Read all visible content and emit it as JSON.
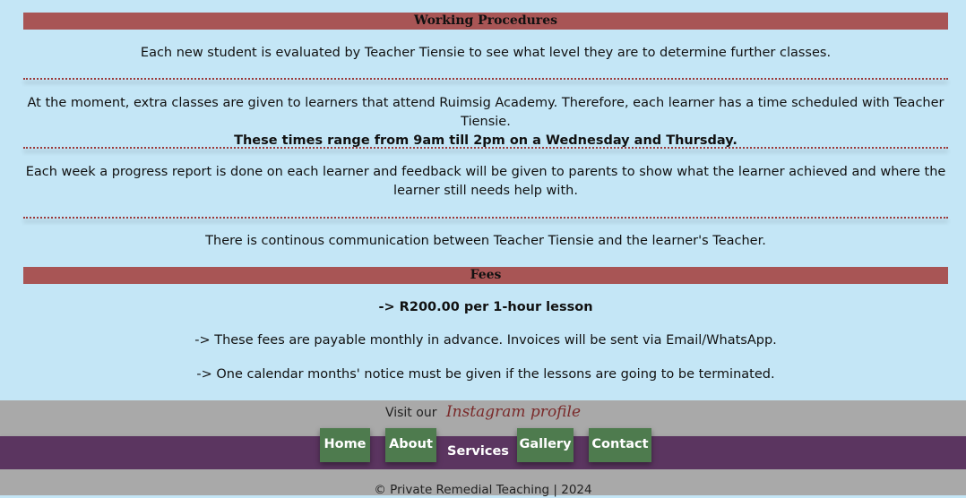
{
  "procedures": {
    "title": "Working Procedures",
    "p1": "Each new student is evaluated by Teacher Tiensie to see what level they are to determine further classes.",
    "p2_line1": "At the moment, extra classes are given to learners that attend Ruimsig Academy. Therefore, each learner has a time scheduled with Teacher Tiensie.",
    "p2_line2": "These times range from 9am till 2pm on a Wednesday and Thursday.",
    "p3": "Each week a progress report is done on each learner and feedback will be given to parents to show what the learner achieved and where the learner still needs help with.",
    "p4": "There is continous communication between Teacher Tiensie and the learner's Teacher."
  },
  "fees": {
    "title": "Fees",
    "line1": "-> R200.00 per 1-hour lesson",
    "line2": "-> These fees are payable monthly in advance. Invoices will be sent via Email/WhatsApp.",
    "line3": "-> One calendar months' notice must be given if the lessons are going to be terminated."
  },
  "footer": {
    "visit_label": "Visit our",
    "instagram_label": "Instagram profile",
    "copyright": "© Private Remedial Teaching | 2024"
  },
  "nav": {
    "home": "Home",
    "about": "About",
    "services": "Services",
    "gallery": "Gallery",
    "contact": "Contact"
  },
  "colors": {
    "background": "#c4e6f6",
    "banner": "#a85555",
    "nav_bar": "#5b3560",
    "nav_button": "#4e7b4e",
    "footer": "#a9a9a9"
  }
}
